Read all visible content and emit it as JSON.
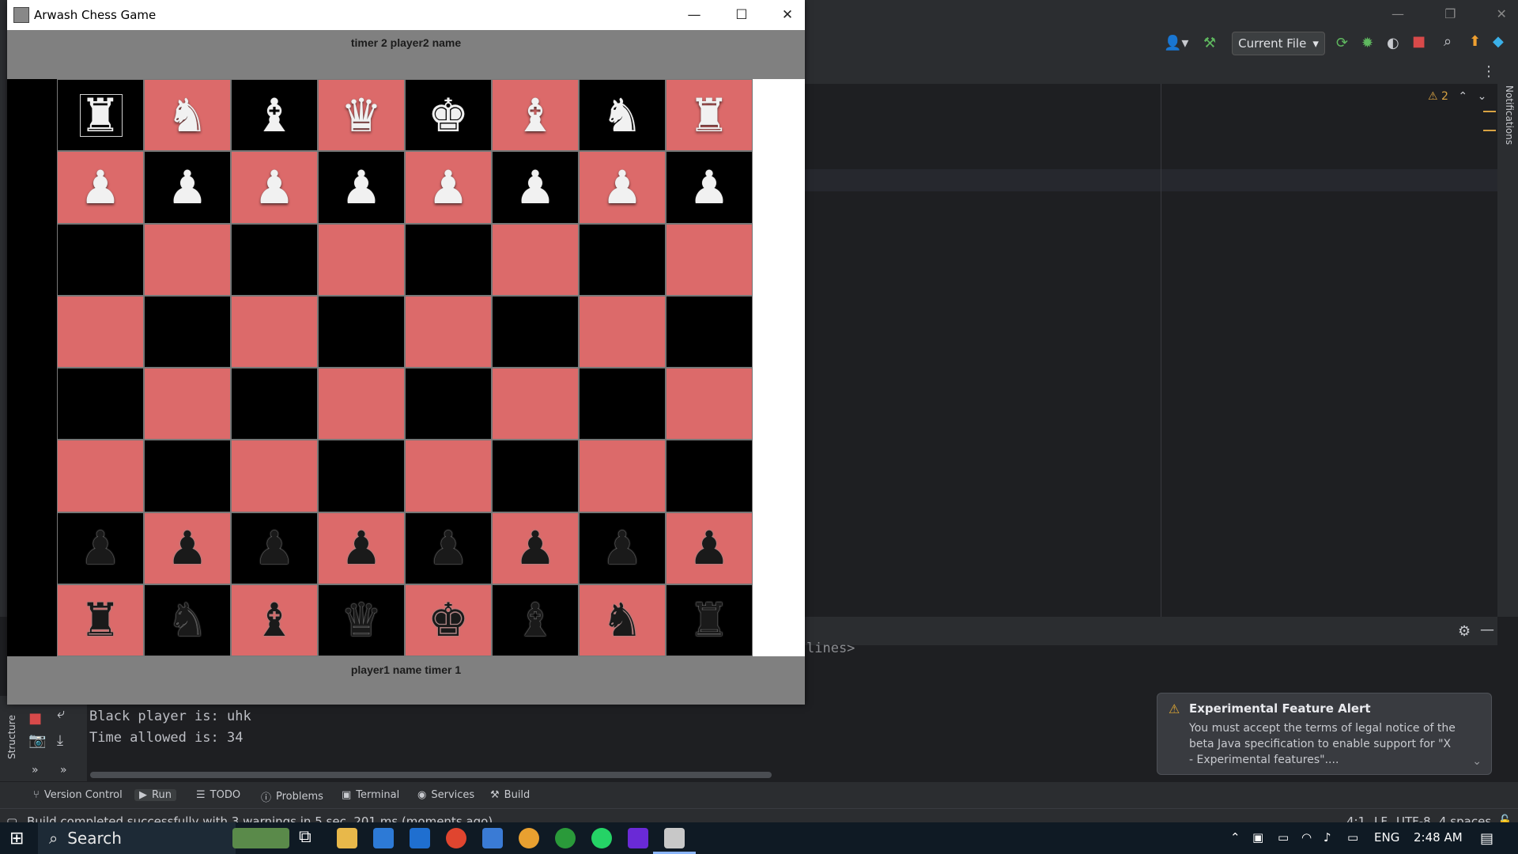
{
  "ide": {
    "run_config": "Current File",
    "warnings_count": "2",
    "notifications_label": "Notifications",
    "structure_label": "Structure",
    "truncated_text": "lines>",
    "console_lines": [
      "Black player is: uhk",
      "Time allowed is: 34"
    ],
    "tool_windows": [
      {
        "label": "Version Control",
        "icon": "branch-icon"
      },
      {
        "label": "Run",
        "icon": "play-icon"
      },
      {
        "label": "TODO",
        "icon": "list-icon"
      },
      {
        "label": "Problems",
        "icon": "info-icon"
      },
      {
        "label": "Terminal",
        "icon": "terminal-icon"
      },
      {
        "label": "Services",
        "icon": "services-icon"
      },
      {
        "label": "Build",
        "icon": "hammer-icon"
      }
    ],
    "status_message": "Build completed successfully with 3 warnings in 5 sec, 201 ms (moments ago)",
    "status_right": {
      "position": "4:1",
      "line_sep": "LF",
      "encoding": "UTF-8",
      "indent": "4 spaces"
    },
    "alert": {
      "title": "Experimental Feature Alert",
      "body": "You must accept the terms of legal notice of the beta Java specification to enable support for \"X - Experimental features\"...."
    }
  },
  "chess_window": {
    "title": "Arwash Chess Game",
    "top_label": "timer 2  player2 name",
    "bottom_label": "player1 name  timer 1",
    "board_rows": [
      [
        "wR",
        "wN",
        "wB",
        "wQ",
        "wK",
        "wB",
        "wN",
        "wR"
      ],
      [
        "wP",
        "wP",
        "wP",
        "wP",
        "wP",
        "wP",
        "wP",
        "wP"
      ],
      [
        "",
        "",
        "",
        "",
        "",
        "",
        "",
        ""
      ],
      [
        "",
        "",
        "",
        "",
        "",
        "",
        "",
        ""
      ],
      [
        "",
        "",
        "",
        "",
        "",
        "",
        "",
        ""
      ],
      [
        "",
        "",
        "",
        "",
        "",
        "",
        "",
        ""
      ],
      [
        "bP",
        "bP",
        "bP",
        "bP",
        "bP",
        "bP",
        "bP",
        "bP"
      ],
      [
        "bR",
        "bN",
        "bB",
        "bQ",
        "bK",
        "bB",
        "bN",
        "bR"
      ]
    ],
    "selected_square": "a8",
    "colors": {
      "light_square": "#dc6a6a",
      "dark_square": "#000000"
    }
  },
  "taskbar": {
    "search_placeholder": "Search",
    "language": "ENG",
    "time": "2:48 AM"
  }
}
